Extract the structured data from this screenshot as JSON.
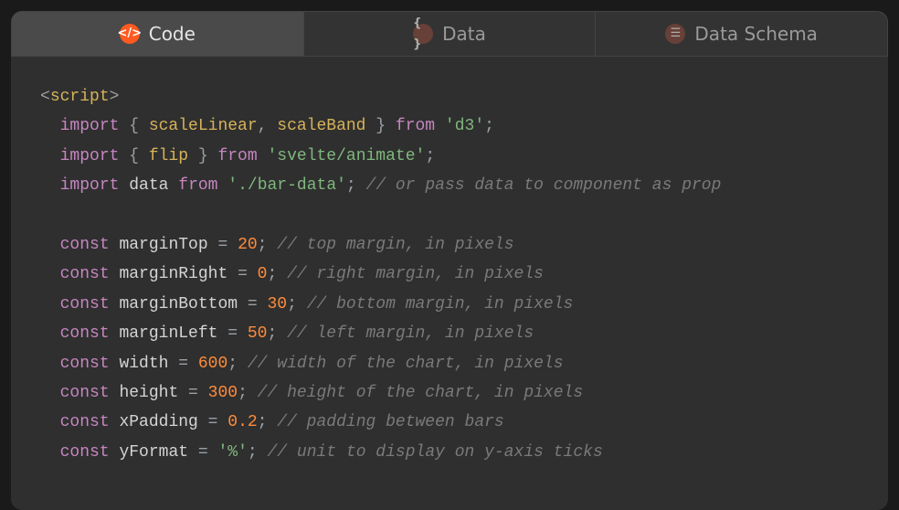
{
  "tabs": {
    "code": {
      "label": "Code"
    },
    "data": {
      "label": "Data"
    },
    "schema": {
      "label": "Data Schema"
    }
  },
  "code": {
    "l1": {
      "a": "<",
      "b": "script",
      "c": ">"
    },
    "l2": {
      "a": "  ",
      "b": "import",
      "c": " { ",
      "d": "scaleLinear",
      "e": ", ",
      "f": "scaleBand",
      "g": " } ",
      "h": "from",
      "i": " ",
      "j": "'d3'",
      "k": ";"
    },
    "l3": {
      "a": "  ",
      "b": "import",
      "c": " { ",
      "d": "flip",
      "e": " } ",
      "f": "from",
      "g": " ",
      "h": "'svelte/animate'",
      "i": ";"
    },
    "l4": {
      "a": "  ",
      "b": "import",
      "c": " ",
      "d": "data",
      "e": " ",
      "f": "from",
      "g": " ",
      "h": "'./bar-data'",
      "i": "; ",
      "j": "// or pass data to component as prop"
    },
    "l5": {
      "a": " "
    },
    "l6": {
      "a": "  ",
      "b": "const",
      "c": " ",
      "d": "marginTop",
      "e": " = ",
      "f": "20",
      "g": "; ",
      "h": "// top margin, in pixels"
    },
    "l7": {
      "a": "  ",
      "b": "const",
      "c": " ",
      "d": "marginRight",
      "e": " = ",
      "f": "0",
      "g": "; ",
      "h": "// right margin, in pixels"
    },
    "l8": {
      "a": "  ",
      "b": "const",
      "c": " ",
      "d": "marginBottom",
      "e": " = ",
      "f": "30",
      "g": "; ",
      "h": "// bottom margin, in pixels"
    },
    "l9": {
      "a": "  ",
      "b": "const",
      "c": " ",
      "d": "marginLeft",
      "e": " = ",
      "f": "50",
      "g": "; ",
      "h": "// left margin, in pixels"
    },
    "l10": {
      "a": "  ",
      "b": "const",
      "c": " ",
      "d": "width",
      "e": " = ",
      "f": "600",
      "g": "; ",
      "h": "// width of the chart, in pixels"
    },
    "l11": {
      "a": "  ",
      "b": "const",
      "c": " ",
      "d": "height",
      "e": " = ",
      "f": "300",
      "g": "; ",
      "h": "// height of the chart, in pixels"
    },
    "l12": {
      "a": "  ",
      "b": "const",
      "c": " ",
      "d": "xPadding",
      "e": " = ",
      "f": "0.2",
      "g": "; ",
      "h": "// padding between bars"
    },
    "l13": {
      "a": "  ",
      "b": "const",
      "c": " ",
      "d": "yFormat",
      "e": " = ",
      "f": "'%'",
      "g": "; ",
      "h": "// unit to display on y-axis ticks"
    }
  }
}
